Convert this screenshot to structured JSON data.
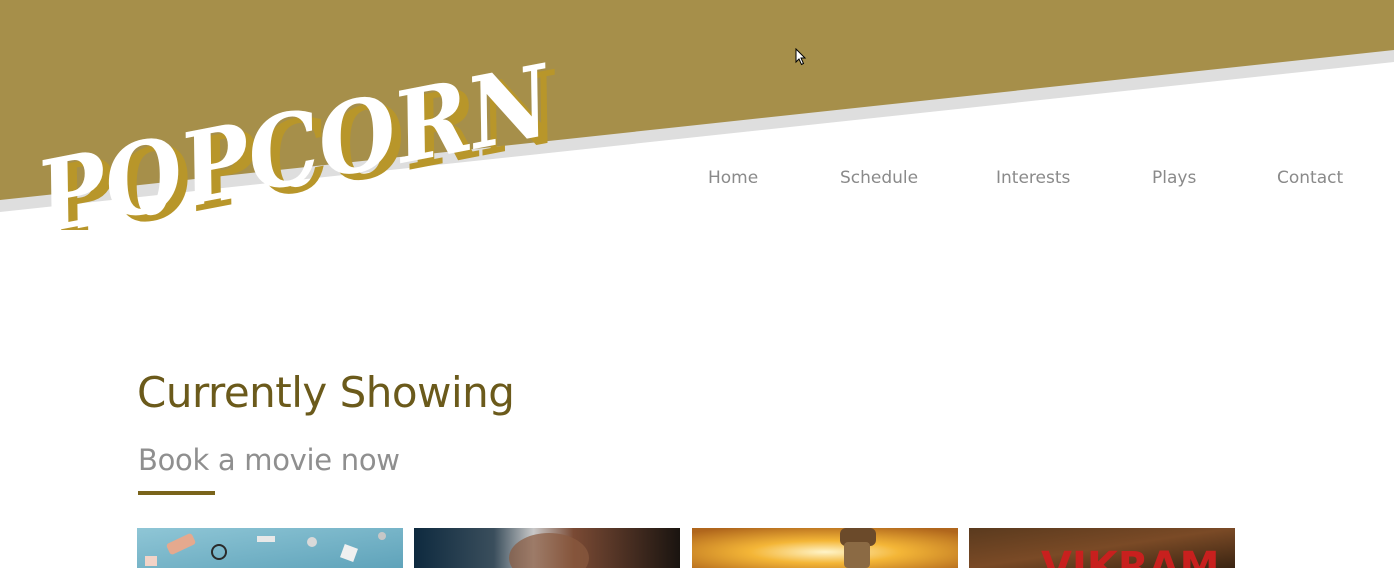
{
  "colors": {
    "header_gold": "#a68f4a",
    "header_shadow": "#dedede",
    "logo_text": "#ffffff",
    "logo_shadow": "#b8962a",
    "title": "#6b5a1b",
    "subtitle": "#8f8f8f",
    "nav_text": "#8a8a8a",
    "accent_underline": "#7a641b"
  },
  "header": {
    "logo_text": "POPCORN"
  },
  "nav": {
    "items": [
      {
        "label": "Home"
      },
      {
        "label": "Schedule"
      },
      {
        "label": "Interests"
      },
      {
        "label": "Plays"
      },
      {
        "label": "Contact"
      }
    ]
  },
  "main": {
    "section_title": "Currently Showing",
    "section_subtitle": "Book a movie now",
    "movies": [
      {
        "name": "movie-poster-1",
        "poster_text": ""
      },
      {
        "name": "movie-poster-2",
        "poster_text": ""
      },
      {
        "name": "movie-poster-3",
        "poster_text": ""
      },
      {
        "name": "movie-poster-4",
        "poster_text": "VIKRAM"
      }
    ]
  }
}
